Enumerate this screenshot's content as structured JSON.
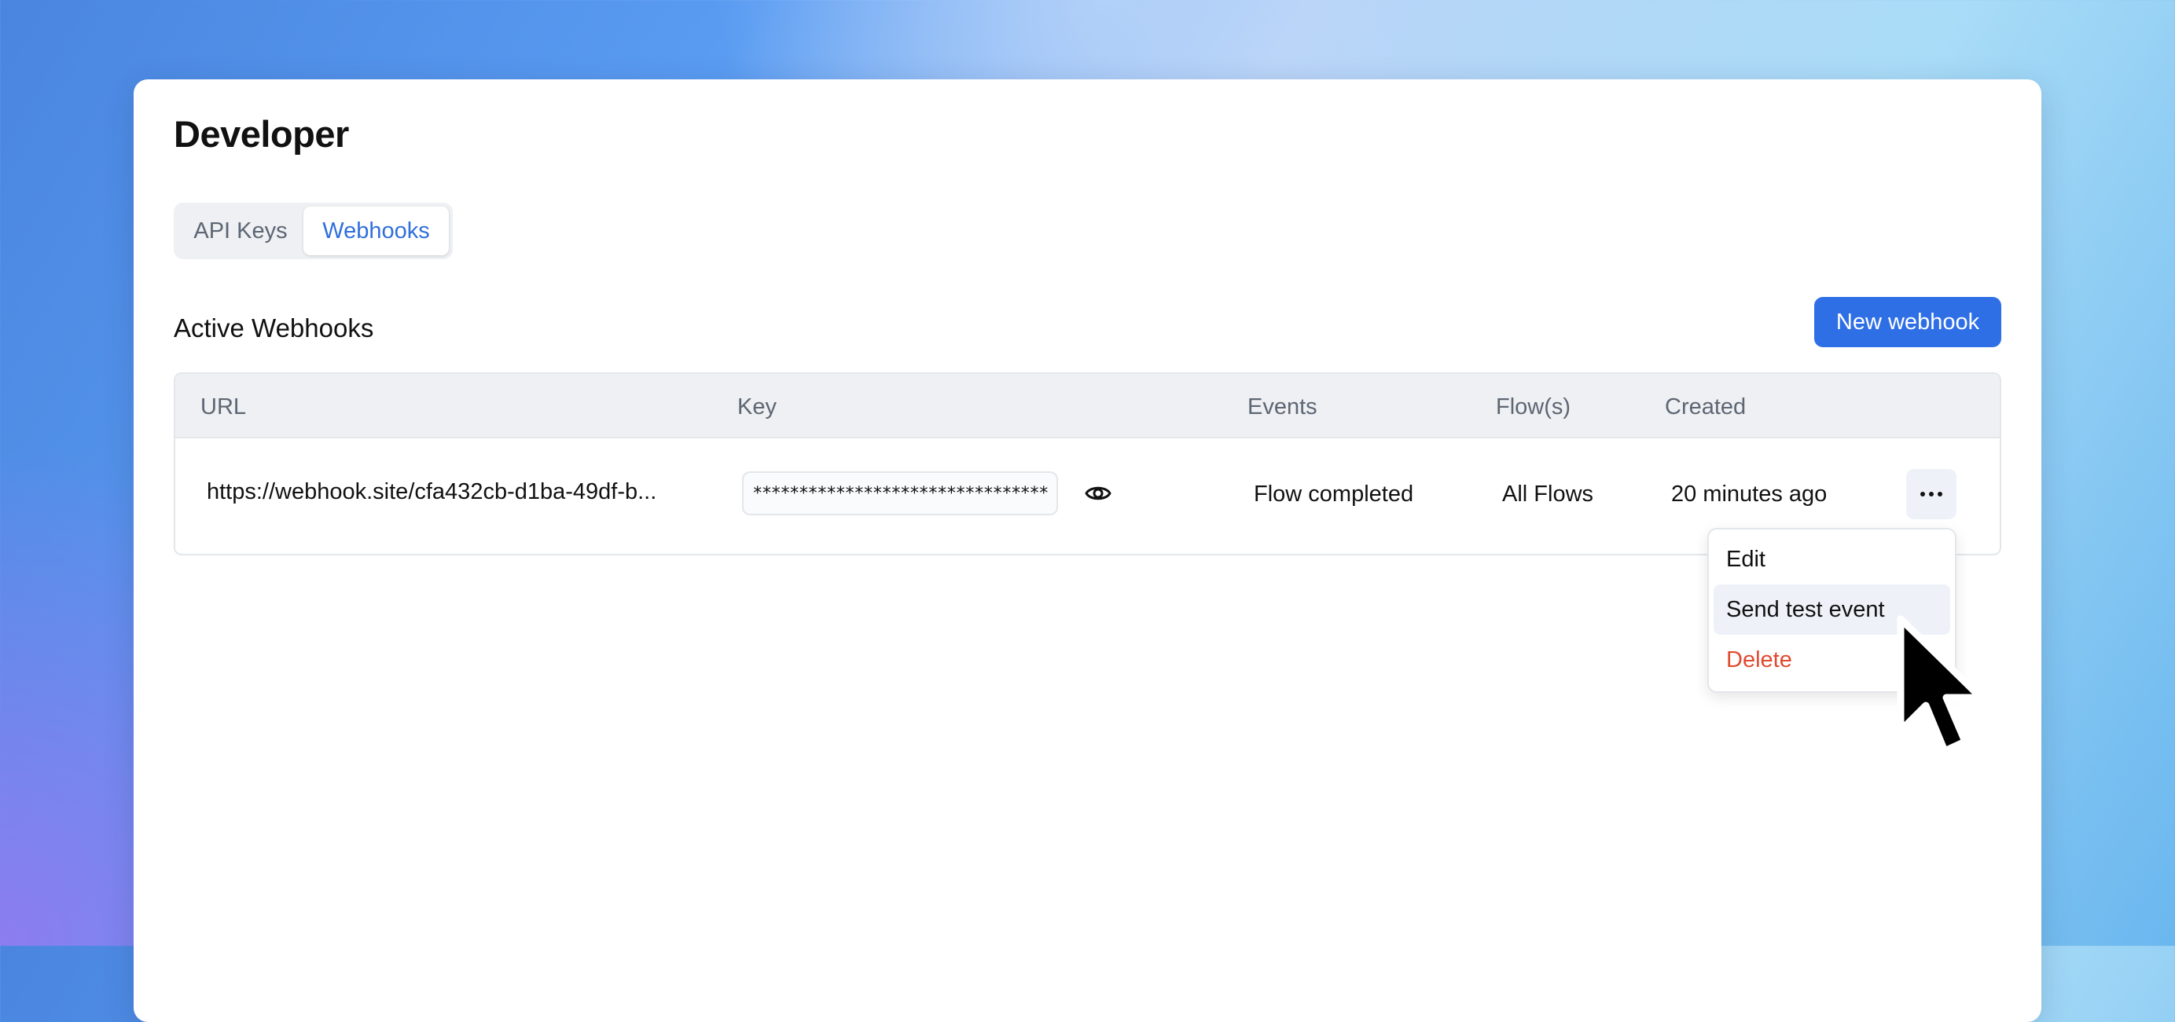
{
  "page": {
    "title": "Developer"
  },
  "tabs": [
    {
      "label": "API Keys",
      "active": false
    },
    {
      "label": "Webhooks",
      "active": true
    }
  ],
  "section": {
    "title": "Active Webhooks",
    "new_button_label": "New webhook"
  },
  "table": {
    "headers": {
      "url": "URL",
      "key": "Key",
      "events": "Events",
      "flows": "Flow(s)",
      "created": "Created"
    },
    "rows": [
      {
        "url": "https://webhook.site/cfa432cb-d1ba-49df-b...",
        "key_masked": "********************************",
        "events": "Flow completed",
        "flows": "All Flows",
        "created": "20 minutes ago"
      }
    ]
  },
  "row_menu": {
    "items": [
      {
        "label": "Edit"
      },
      {
        "label": "Send test event",
        "highlighted": true
      },
      {
        "label": "Delete",
        "destructive": true
      }
    ]
  },
  "icons": {
    "reveal": "eye-icon",
    "more": "more-horizontal-icon",
    "pointer": "mouse-cursor-icon"
  },
  "colors": {
    "accent": "#2f6fe6",
    "active_tab_text": "#2f6fdc",
    "danger": "#e04a2f",
    "muted_text": "#5d6673",
    "header_bg": "#eef0f3"
  }
}
